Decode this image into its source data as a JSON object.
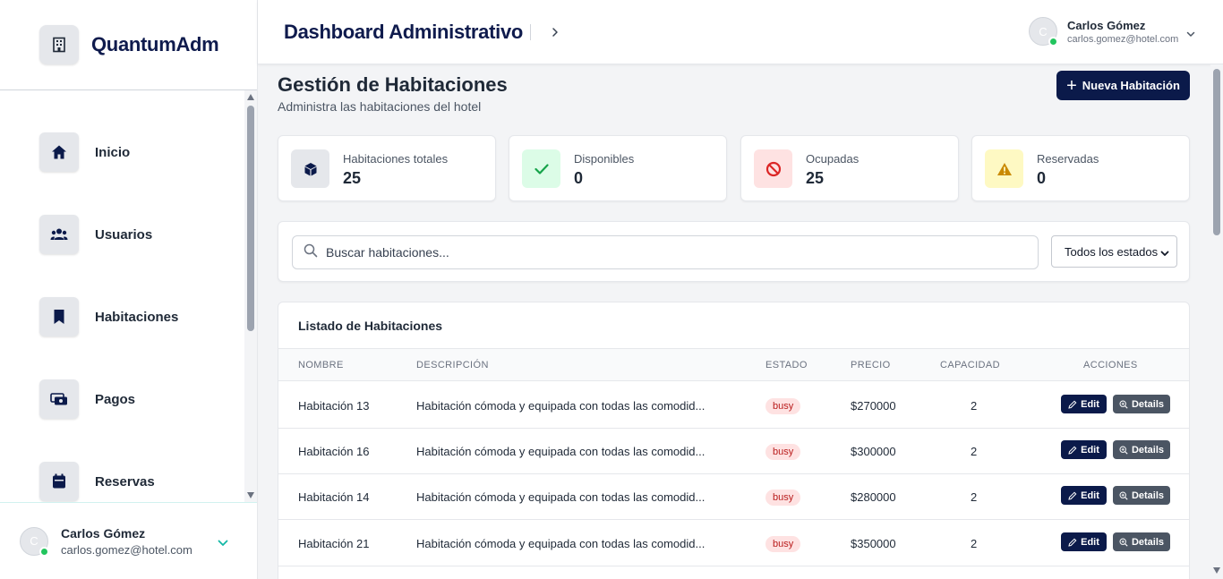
{
  "brand": {
    "name": "QuantumAdm",
    "icon": "building-icon"
  },
  "sidebar": {
    "items": [
      {
        "label": "Inicio",
        "icon": "home-icon"
      },
      {
        "label": "Usuarios",
        "icon": "users-icon"
      },
      {
        "label": "Habitaciones",
        "icon": "bookmark-icon"
      },
      {
        "label": "Pagos",
        "icon": "money-icon"
      },
      {
        "label": "Reservas",
        "icon": "calendar-icon"
      }
    ],
    "user": {
      "initial": "C",
      "name": "Carlos Gómez",
      "email": "carlos.gomez@hotel.com"
    }
  },
  "header": {
    "title": "Dashboard Administrativo",
    "user": {
      "initial": "C",
      "name": "Carlos Gómez",
      "email": "carlos.gomez@hotel.com"
    }
  },
  "page": {
    "title": "Gestión de Habitaciones",
    "subtitle": "Administra las habitaciones del hotel",
    "new_button": "Nueva Habitación"
  },
  "stats": [
    {
      "label": "Habitaciones totales",
      "value": "25",
      "icon": "cube-icon",
      "color": "#e5e7eb"
    },
    {
      "label": "Disponibles",
      "value": "0",
      "icon": "check-icon",
      "color": "#dcfce7"
    },
    {
      "label": "Ocupadas",
      "value": "25",
      "icon": "ban-icon",
      "color": "#fee2e2"
    },
    {
      "label": "Reservadas",
      "value": "0",
      "icon": "warning-icon",
      "color": "#fef9c3"
    }
  ],
  "filters": {
    "search_placeholder": "Buscar habitaciones...",
    "status_selected": "Todos los estados"
  },
  "table": {
    "title": "Listado de Habitaciones",
    "columns": [
      "NOMBRE",
      "DESCRIPCIÓN",
      "ESTADO",
      "PRECIO",
      "CAPACIDAD",
      "ACCIONES"
    ],
    "edit_label": "Edit",
    "details_label": "Details",
    "rows": [
      {
        "name": "Habitación 13",
        "description": "Habitación cómoda y equipada con todas las comodid...",
        "status": "busy",
        "price": "$270000",
        "capacity": "2"
      },
      {
        "name": "Habitación 16",
        "description": "Habitación cómoda y equipada con todas las comodid...",
        "status": "busy",
        "price": "$300000",
        "capacity": "2"
      },
      {
        "name": "Habitación 14",
        "description": "Habitación cómoda y equipada con todas las comodid...",
        "status": "busy",
        "price": "$280000",
        "capacity": "2"
      },
      {
        "name": "Habitación 21",
        "description": "Habitación cómoda y equipada con todas las comodid...",
        "status": "busy",
        "price": "$350000",
        "capacity": "2"
      }
    ]
  },
  "colors": {
    "brand_navy": "#0b1a4a",
    "busy_badge_bg": "#fee2e2",
    "busy_badge_text": "#b91c1c",
    "online": "#22c55e"
  }
}
